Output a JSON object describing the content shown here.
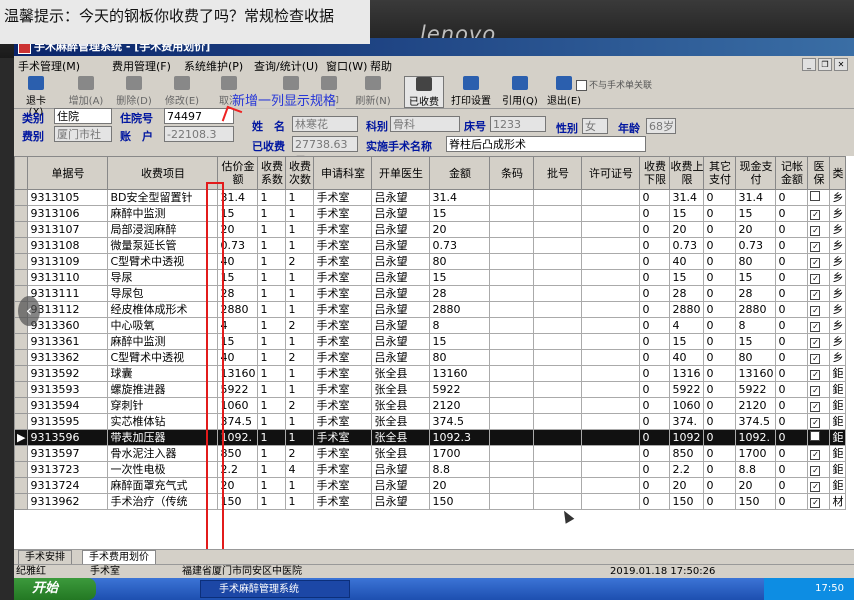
{
  "overlay_note": "温馨提示：今天的钢板你收费了吗？常规检查收据",
  "monitor_brand": "lenovo",
  "window": {
    "title": "手术麻醉管理系统  - [手术费用划价]"
  },
  "menu": [
    "手术管理(M)",
    "费用管理(F)",
    "系统维护(P)",
    "查询/统计(U)",
    "窗口(W)",
    "帮助"
  ],
  "toolbar": {
    "exit": "退卡(X)",
    "add": "增加(A)",
    "delete": "删除(D)",
    "edit": "修改(E)",
    "cancel": "取消",
    "save": "保存",
    "print": "打印",
    "refresh": "刷新(N)",
    "charged": "已收费",
    "print_setup": "打印设置",
    "cite": "引用(Q)",
    "logout": "退出(E)"
  },
  "annotation": "新增一列显示规格",
  "form": {
    "category_label": "类别",
    "category_value": "住院",
    "inpatient_no_label": "住院号",
    "inpatient_no_value": "74497",
    "name_label": "姓　名",
    "name_value": "林寒花",
    "dept_label": "科别",
    "dept_value": "骨科",
    "bed_label": "床号",
    "bed_value": "1233",
    "fee_label": "费别",
    "fee_value": "厦门市社",
    "account_label": "账　户",
    "account_value": "-22108.3",
    "charged_label": "已收费",
    "charged_value": "27738.63元",
    "surgery_label": "实施手术名称",
    "surgery_value": "脊柱后凸成形术",
    "gender_label": "性别",
    "gender_value": "女",
    "age_label": "年龄",
    "age_value": "68岁",
    "no_surgery_chk": "不与手术单关联"
  },
  "table": {
    "headers": [
      "单据号",
      "收费项目",
      "估价金额",
      "收费系数",
      "收费次数",
      "申请科室",
      "开单医生",
      "金额",
      "条码",
      "批号",
      "许可证号",
      "收费下限",
      "收费上限",
      "其它支付",
      "现金支付",
      "记帐金额",
      "医保",
      "类"
    ],
    "rows": [
      [
        "9313105",
        "BD安全型留置针",
        "31.4",
        "1",
        "1",
        "手术室",
        "吕永望",
        "31.4",
        "",
        "",
        "",
        "0",
        "31.4",
        "0",
        "31.4",
        "0",
        "",
        "乡"
      ],
      [
        "9313106",
        "麻醉中监测",
        "15",
        "1",
        "1",
        "手术室",
        "吕永望",
        "15",
        "",
        "",
        "",
        "0",
        "15",
        "0",
        "15",
        "0",
        "✓",
        "乡"
      ],
      [
        "9313107",
        "局部浸润麻醉",
        "20",
        "1",
        "1",
        "手术室",
        "吕永望",
        "20",
        "",
        "",
        "",
        "0",
        "20",
        "0",
        "20",
        "0",
        "✓",
        "乡"
      ],
      [
        "9313108",
        "微量泵延长管",
        "0.73",
        "1",
        "1",
        "手术室",
        "吕永望",
        "0.73",
        "",
        "",
        "",
        "0",
        "0.73",
        "0",
        "0.73",
        "0",
        "✓",
        "乡"
      ],
      [
        "9313109",
        "C型臂术中透视",
        "40",
        "1",
        "2",
        "手术室",
        "吕永望",
        "80",
        "",
        "",
        "",
        "0",
        "40",
        "0",
        "80",
        "0",
        "✓",
        "乡"
      ],
      [
        "9313110",
        "导尿",
        "15",
        "1",
        "1",
        "手术室",
        "吕永望",
        "15",
        "",
        "",
        "",
        "0",
        "15",
        "0",
        "15",
        "0",
        "✓",
        "乡"
      ],
      [
        "9313111",
        "导尿包",
        "28",
        "1",
        "1",
        "手术室",
        "吕永望",
        "28",
        "",
        "",
        "",
        "0",
        "28",
        "0",
        "28",
        "0",
        "✓",
        "乡"
      ],
      [
        "9313112",
        "经皮椎体成形术",
        "2880",
        "1",
        "1",
        "手术室",
        "吕永望",
        "2880",
        "",
        "",
        "",
        "0",
        "2880",
        "0",
        "2880",
        "0",
        "✓",
        "乡"
      ],
      [
        "9313360",
        "中心吸氧",
        "4",
        "1",
        "2",
        "手术室",
        "吕永望",
        "8",
        "",
        "",
        "",
        "0",
        "4",
        "0",
        "8",
        "0",
        "✓",
        "乡"
      ],
      [
        "9313361",
        "麻醉中监测",
        "15",
        "1",
        "1",
        "手术室",
        "吕永望",
        "15",
        "",
        "",
        "",
        "0",
        "15",
        "0",
        "15",
        "0",
        "✓",
        "乡"
      ],
      [
        "9313362",
        "C型臂术中透视",
        "40",
        "1",
        "2",
        "手术室",
        "吕永望",
        "80",
        "",
        "",
        "",
        "0",
        "40",
        "0",
        "80",
        "0",
        "✓",
        "乡"
      ],
      [
        "9313592",
        "球囊",
        "13160",
        "1",
        "1",
        "手术室",
        "张全县",
        "13160",
        "",
        "",
        "",
        "0",
        "1316",
        "0",
        "13160",
        "0",
        "✓",
        "鉅"
      ],
      [
        "9313593",
        "螺旋推进器",
        "5922",
        "1",
        "1",
        "手术室",
        "张全县",
        "5922",
        "",
        "",
        "",
        "0",
        "5922",
        "0",
        "5922",
        "0",
        "✓",
        "鉅"
      ],
      [
        "9313594",
        "穿刺针",
        "1060",
        "1",
        "2",
        "手术室",
        "张全县",
        "2120",
        "",
        "",
        "",
        "0",
        "1060",
        "0",
        "2120",
        "0",
        "✓",
        "鉅"
      ],
      [
        "9313595",
        "实芯椎体钻",
        "374.5",
        "1",
        "1",
        "手术室",
        "张全县",
        "374.5",
        "",
        "",
        "",
        "0",
        "374.",
        "0",
        "374.5",
        "0",
        "✓",
        "鉅"
      ],
      [
        "9313596",
        "带表加压器",
        "1092.",
        "1",
        "1",
        "手术室",
        "张全县",
        "1092.3",
        "",
        "",
        "",
        "0",
        "1092",
        "0",
        "1092.",
        "0",
        "",
        "鉅"
      ],
      [
        "9313597",
        "骨水泥注入器",
        "850",
        "1",
        "2",
        "手术室",
        "张全县",
        "1700",
        "",
        "",
        "",
        "0",
        "850",
        "0",
        "1700",
        "0",
        "✓",
        "鉅"
      ],
      [
        "9313723",
        "一次性电极",
        "2.2",
        "1",
        "4",
        "手术室",
        "吕永望",
        "8.8",
        "",
        "",
        "",
        "0",
        "2.2",
        "0",
        "8.8",
        "0",
        "✓",
        "鉅"
      ],
      [
        "9313724",
        "麻醉面罩充气式",
        "20",
        "1",
        "1",
        "手术室",
        "吕永望",
        "20",
        "",
        "",
        "",
        "0",
        "20",
        "0",
        "20",
        "0",
        "✓",
        "鉅"
      ],
      [
        "9313962",
        "手术治疗（传统",
        "150",
        "1",
        "1",
        "手术室",
        "吕永望",
        "150",
        "",
        "",
        "",
        "0",
        "150",
        "0",
        "150",
        "0",
        "✓",
        "材"
      ]
    ],
    "selected_row_no": "9313596"
  },
  "tabs": [
    "手术安排",
    "手术费用划价"
  ],
  "status": {
    "user": "纪雅红",
    "dept": "手术室",
    "hospital": "福建省厦门市同安区中医院",
    "datetime": "2019.01.18  17:50:26"
  },
  "taskbar": {
    "start": "开始",
    "app": "手术麻醉管理系统",
    "clock": "17:50"
  }
}
